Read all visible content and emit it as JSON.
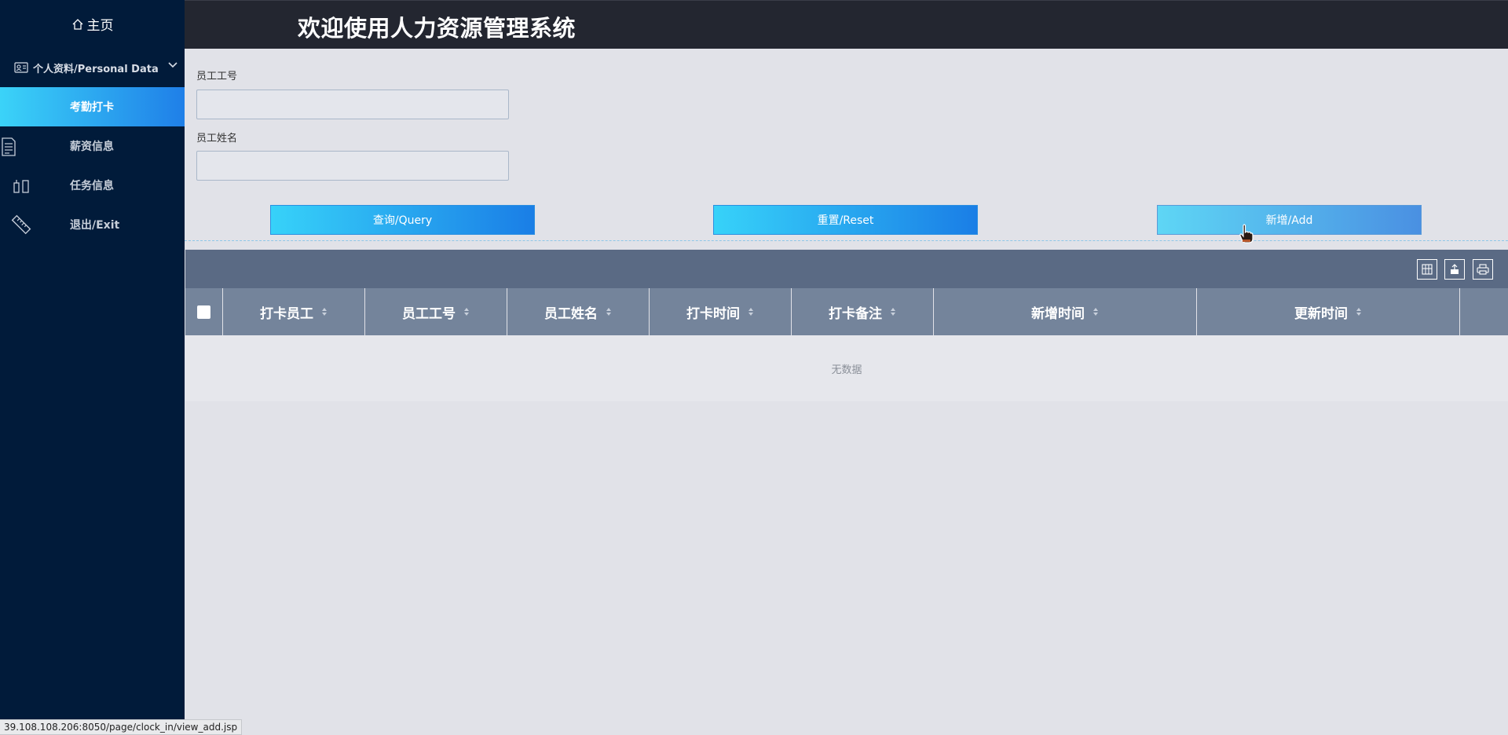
{
  "header": {
    "title": "欢迎使用人力资源管理系统"
  },
  "sidebar": {
    "home": "主页",
    "group": "个人资料/Personal Data",
    "items": [
      {
        "label": "考勤打卡",
        "icon": "none",
        "active": true
      },
      {
        "label": "薪资信息",
        "icon": "document-icon"
      },
      {
        "label": "任务信息",
        "icon": "tasks-icon"
      },
      {
        "label": "退出/Exit",
        "icon": "ruler-icon"
      }
    ]
  },
  "form": {
    "employee_id_label": "员工工号",
    "employee_id_value": "",
    "employee_name_label": "员工姓名",
    "employee_name_value": ""
  },
  "buttons": {
    "query": "查询/Query",
    "reset": "重置/Reset",
    "add": "新增/Add"
  },
  "table": {
    "columns": [
      "打卡员工",
      "员工工号",
      "员工姓名",
      "打卡时间",
      "打卡备注",
      "新增时间",
      "更新时间"
    ],
    "rows": [],
    "empty_text": "无数据"
  },
  "statusbar": {
    "url": "39.108.108.206:8050/page/clock_in/view_add.jsp"
  },
  "colors": {
    "sidebar_bg": "#011b3a",
    "header_bg": "#232630",
    "accent_start": "#37d2f9",
    "accent_end": "#1a7ee6",
    "table_toolbar": "#5a6a84",
    "table_header": "#74849b"
  }
}
